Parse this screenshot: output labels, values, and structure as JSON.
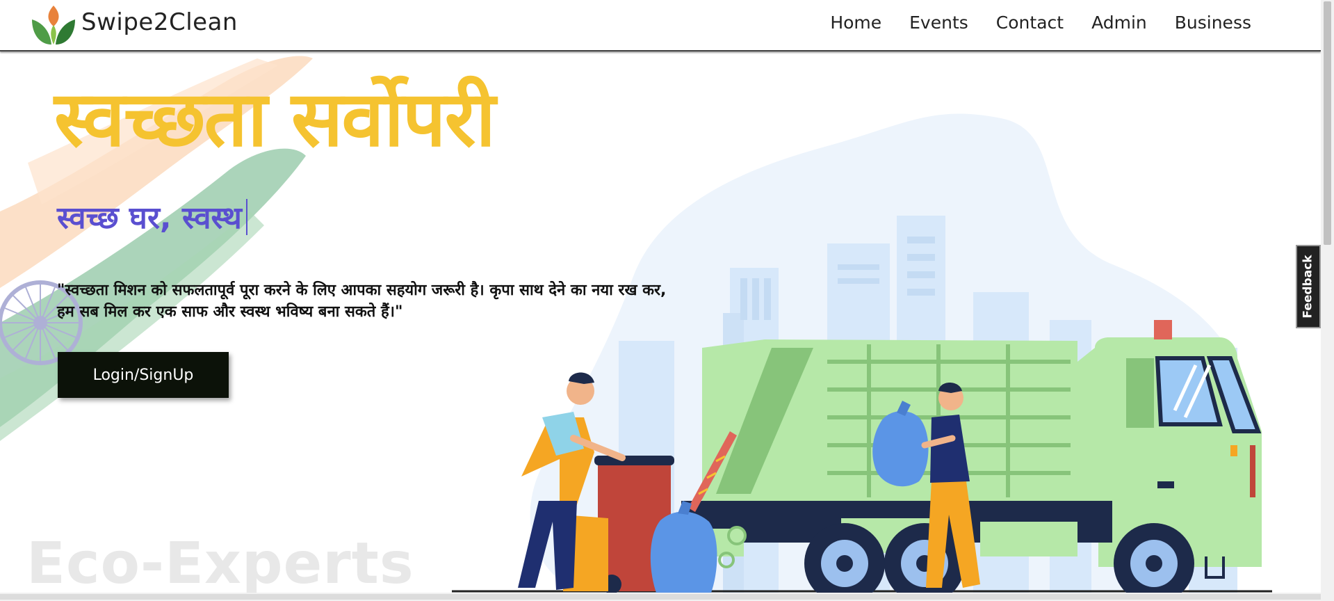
{
  "header": {
    "brand": "Swipe2Clean",
    "logo_icon": "leaf-flame-logo",
    "nav": [
      "Home",
      "Events",
      "Contact",
      "Admin",
      "Business"
    ]
  },
  "hero": {
    "title": "स्वच्छता सर्वोपरी",
    "subtitle": "स्वच्छ घर, स्वस्थ",
    "quote": "\"स्वच्छता मिशन को सफलतापूर्व पूरा करने के लिए आपका सहयोग जरूरी है। कृपा साथ देने का नया रख कर, हम सब मिल कर एक साफ और स्वस्थ भविष्य बना सकते हैं।\"",
    "cta_label": "Login/SignUp",
    "watermark": "Eco-Experts"
  },
  "feedback_tab": {
    "label": "Feedback"
  },
  "colors": {
    "title": "#f5c330",
    "subtitle": "#5a4fd0",
    "cta_bg": "#0c1209",
    "truck_green": "#b6e8a8",
    "bin_red": "#c0453a",
    "bag_blue": "#5b95e6"
  },
  "illustration": {
    "subject": "garbage-truck-workers",
    "icons": [
      "city-skyline-icon",
      "garbage-truck-icon",
      "worker-with-bin-icon",
      "worker-with-bag-icon",
      "ashoka-chakra-icon"
    ]
  }
}
